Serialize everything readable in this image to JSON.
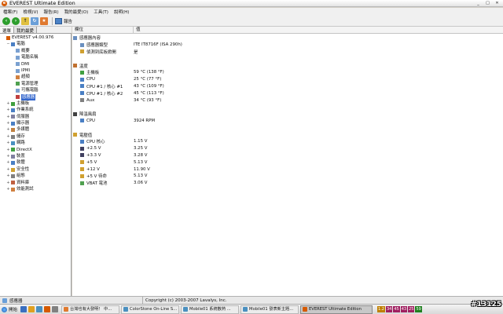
{
  "window": {
    "title": "EVEREST Ultimate Edition",
    "controls": [
      "_",
      "□",
      "✕"
    ]
  },
  "menu": [
    "檔案(F)",
    "檢視(V)",
    "報告(R)",
    "我的最愛(O)",
    "工具(T)",
    "說明(H)"
  ],
  "toolbar": {
    "report_label": "報告"
  },
  "tabs": {
    "menu": "選單",
    "favorites": "我的最愛"
  },
  "tree": [
    {
      "label": "EVEREST v4.00.976",
      "indent": 0,
      "exp": "",
      "color": "#d65a00"
    },
    {
      "label": "電腦",
      "indent": 1,
      "exp": "−",
      "color": "#4a7fc4"
    },
    {
      "label": "概要",
      "indent": 2,
      "exp": "",
      "color": "#7aa0d0"
    },
    {
      "label": "電腦名稱",
      "indent": 2,
      "exp": "",
      "color": "#7aa0d0"
    },
    {
      "label": "DMI",
      "indent": 2,
      "exp": "",
      "color": "#7aa0d0"
    },
    {
      "label": "IPMI",
      "indent": 2,
      "exp": "",
      "color": "#7aa0d0"
    },
    {
      "label": "超頻",
      "indent": 2,
      "exp": "",
      "color": "#d08040"
    },
    {
      "label": "電源管理",
      "indent": 2,
      "exp": "",
      "color": "#50a050"
    },
    {
      "label": "可攜電腦",
      "indent": 2,
      "exp": "",
      "color": "#7aa0d0"
    },
    {
      "label": "感應器",
      "indent": 2,
      "exp": "",
      "color": "#c04040",
      "selected": true
    },
    {
      "label": "主機板",
      "indent": 1,
      "exp": "+",
      "color": "#40a040"
    },
    {
      "label": "作業系統",
      "indent": 1,
      "exp": "+",
      "color": "#4a7fc4"
    },
    {
      "label": "伺服器",
      "indent": 1,
      "exp": "+",
      "color": "#8080a0"
    },
    {
      "label": "顯示器",
      "indent": 1,
      "exp": "+",
      "color": "#4a7fc4"
    },
    {
      "label": "多媒體",
      "indent": 1,
      "exp": "+",
      "color": "#c08040"
    },
    {
      "label": "儲存",
      "indent": 1,
      "exp": "+",
      "color": "#808080"
    },
    {
      "label": "網路",
      "indent": 1,
      "exp": "+",
      "color": "#4a90c0"
    },
    {
      "label": "DirectX",
      "indent": 1,
      "exp": "+",
      "color": "#40a040"
    },
    {
      "label": "裝置",
      "indent": 1,
      "exp": "+",
      "color": "#8080a0"
    },
    {
      "label": "軟體",
      "indent": 1,
      "exp": "+",
      "color": "#4a7fc4"
    },
    {
      "label": "安全性",
      "indent": 1,
      "exp": "+",
      "color": "#d0a030"
    },
    {
      "label": "組態",
      "indent": 1,
      "exp": "+",
      "color": "#808080"
    },
    {
      "label": "資料庫",
      "indent": 1,
      "exp": "+",
      "color": "#c06040"
    },
    {
      "label": "效能測試",
      "indent": 1,
      "exp": "+",
      "color": "#d08040"
    }
  ],
  "columns": {
    "field": "欄位",
    "value": "值"
  },
  "sections": [
    {
      "title": "感應器內容",
      "color": "#6a8fbf",
      "rows": [
        {
          "name": "感應器類型",
          "value": "ITE IT8716F  (ISA 290h)",
          "color": "#6a8fbf"
        },
        {
          "name": "偵測到底板掀開",
          "value": "是",
          "color": "#d0a030"
        }
      ]
    },
    {
      "title": "溫度",
      "color": "#c07030",
      "rows": [
        {
          "name": "主機板",
          "value": "59 °C  (138 °F)",
          "color": "#40a040"
        },
        {
          "name": "CPU",
          "value": "25 °C  (77 °F)",
          "color": "#4a7fc4"
        },
        {
          "name": "CPU #1 / 核心 #1",
          "value": "43 °C  (109 °F)",
          "color": "#4a7fc4"
        },
        {
          "name": "CPU #1 / 核心 #2",
          "value": "45 °C  (113 °F)",
          "color": "#4a7fc4"
        },
        {
          "name": "Aux",
          "value": "34 °C  (93 °F)",
          "color": "#808080"
        }
      ]
    },
    {
      "title": "降溫風扇",
      "color": "#404040",
      "rows": [
        {
          "name": "CPU",
          "value": "3924 RPM",
          "color": "#4a7fc4"
        }
      ]
    },
    {
      "title": "電壓值",
      "color": "#d0a030",
      "rows": [
        {
          "name": "CPU 核心",
          "value": "1.15 V",
          "color": "#4a7fc4"
        },
        {
          "name": "+2.5 V",
          "value": "3.25 V",
          "color": "#404060"
        },
        {
          "name": "+3.3 V",
          "value": "3.28 V",
          "color": "#404060"
        },
        {
          "name": "+5 V",
          "value": "5.13 V",
          "color": "#d0a030"
        },
        {
          "name": "+12 V",
          "value": "11.90 V",
          "color": "#d0a030"
        },
        {
          "name": "+5 V 待命",
          "value": "5.13 V",
          "color": "#d0a030"
        },
        {
          "name": "VBAT 電池",
          "value": "3.06 V",
          "color": "#50a050"
        }
      ]
    }
  ],
  "status": {
    "left": "感應器",
    "center": "Copyright (c) 2003-2007 Lavalys, Inc."
  },
  "taskbar": {
    "start": "開始",
    "tasks": [
      {
        "label": "台灣也有大發明！  中...",
        "color": "#e07a30",
        "active": false
      },
      {
        "label": "ColorStone On-Line S...",
        "color": "#4a90c0",
        "active": false
      },
      {
        "label": "Mobile01 系統散熱 ...",
        "color": "#4a90c0",
        "active": false
      },
      {
        "label": "Mobile01 發表新主題...",
        "color": "#4a90c0",
        "active": false
      },
      {
        "label": "EVEREST Ultimate Edition",
        "color": "#d65a00",
        "active": true
      }
    ],
    "tray": [
      {
        "text": "1.2",
        "color": "#c08000"
      },
      {
        "text": "34",
        "color": "#a02060"
      },
      {
        "text": "45",
        "color": "#a02060"
      },
      {
        "text": "43",
        "color": "#a02060"
      },
      {
        "text": "25",
        "color": "#a02060"
      },
      {
        "text": "59",
        "color": "#208020"
      }
    ]
  },
  "watermark": "#13125"
}
